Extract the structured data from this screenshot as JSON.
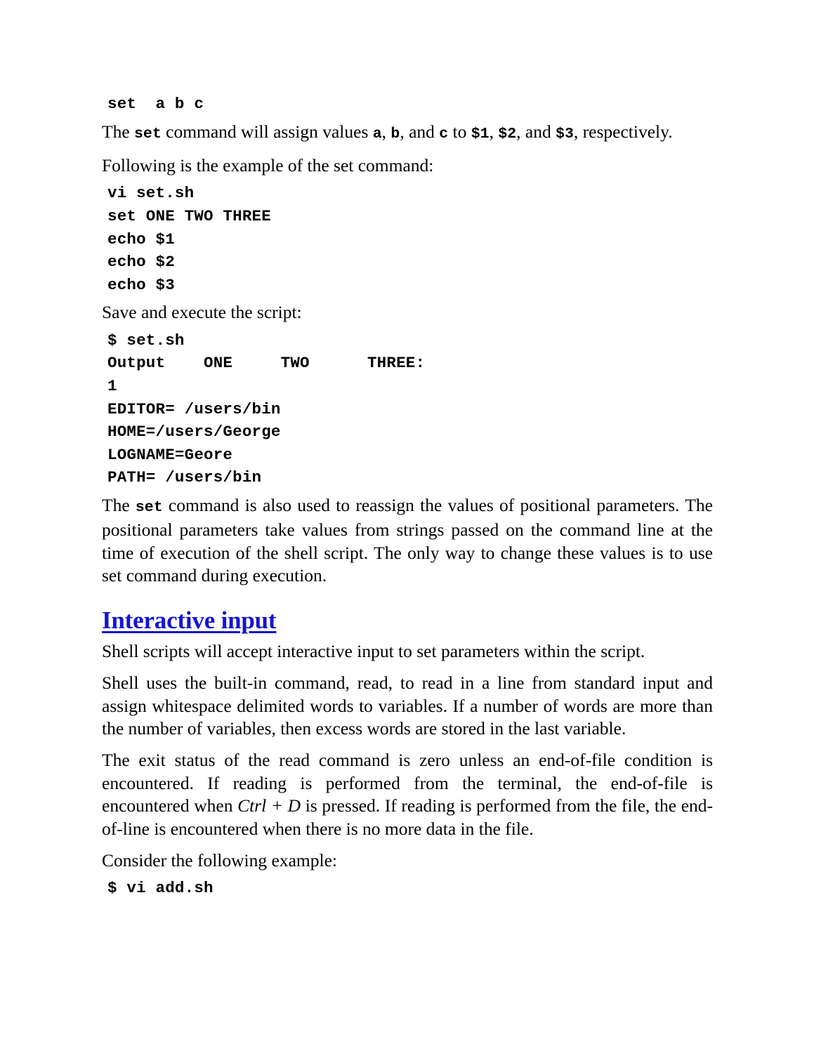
{
  "page": {
    "background_color": "#ffffff",
    "text_color": "#000000",
    "heading_color": "#1414d2"
  },
  "blocks": {
    "code_set_abc": "set  a b c",
    "para_set_assign": {
      "t1": "The ",
      "c1": "set",
      "t2": " command will assign values ",
      "c2": "a",
      "t3": ", ",
      "c3": "b",
      "t4": ", and ",
      "c4": "c",
      "t5": " to ",
      "c5": "$1",
      "t6": ", ",
      "c6": "$2",
      "t7": ", and ",
      "c7": "$3",
      "t8": ", respectively."
    },
    "para_following": "Following is the example of the set command:",
    "code_script": [
      "vi set.sh",
      "set ONE TWO THREE",
      "echo $1",
      "echo $2",
      "echo $3"
    ],
    "para_save": "Save and execute the script:",
    "code_output": [
      "$ set.sh",
      "Output   ONE     THREE:",
      "1",
      "EDITOR= /users/bin",
      "HOME=/users/George",
      "LOGNAME=Geore",
      "PATH= /users/bin"
    ],
    "code_output_line2": {
      "label": "Output",
      "col1": "ONE",
      "col2": "TWO",
      "col3": "THREE:"
    },
    "para_reassign": {
      "t1": "The ",
      "c1": "set",
      "t2": " command is also used to reassign the values of positional parameters. The positional parameters take values from strings passed on the command line at the time of execution of the shell script. The only way to change these values is to use set command during execution."
    },
    "heading_interactive": "Interactive input",
    "para_shell_scripts": "Shell scripts will accept interactive input to set parameters within the script.",
    "para_shell_uses": "Shell uses the built-in command, read, to read in a line from standard input and assign whitespace delimited words to variables. If a number of words are more than the number of variables, then excess words are stored in the last variable.",
    "para_exit_status": {
      "t1": "The exit status of the read command is zero unless an end-of-file condition is encountered. If reading is performed from the terminal, the end-of-file is encountered when ",
      "i1": "Ctrl + D",
      "t2": " is pressed. If reading is performed from the file, the end-of-line is encountered when there is no more data in the file."
    },
    "para_consider": "Consider the following example:",
    "code_vi_add": "$ vi add.sh"
  }
}
